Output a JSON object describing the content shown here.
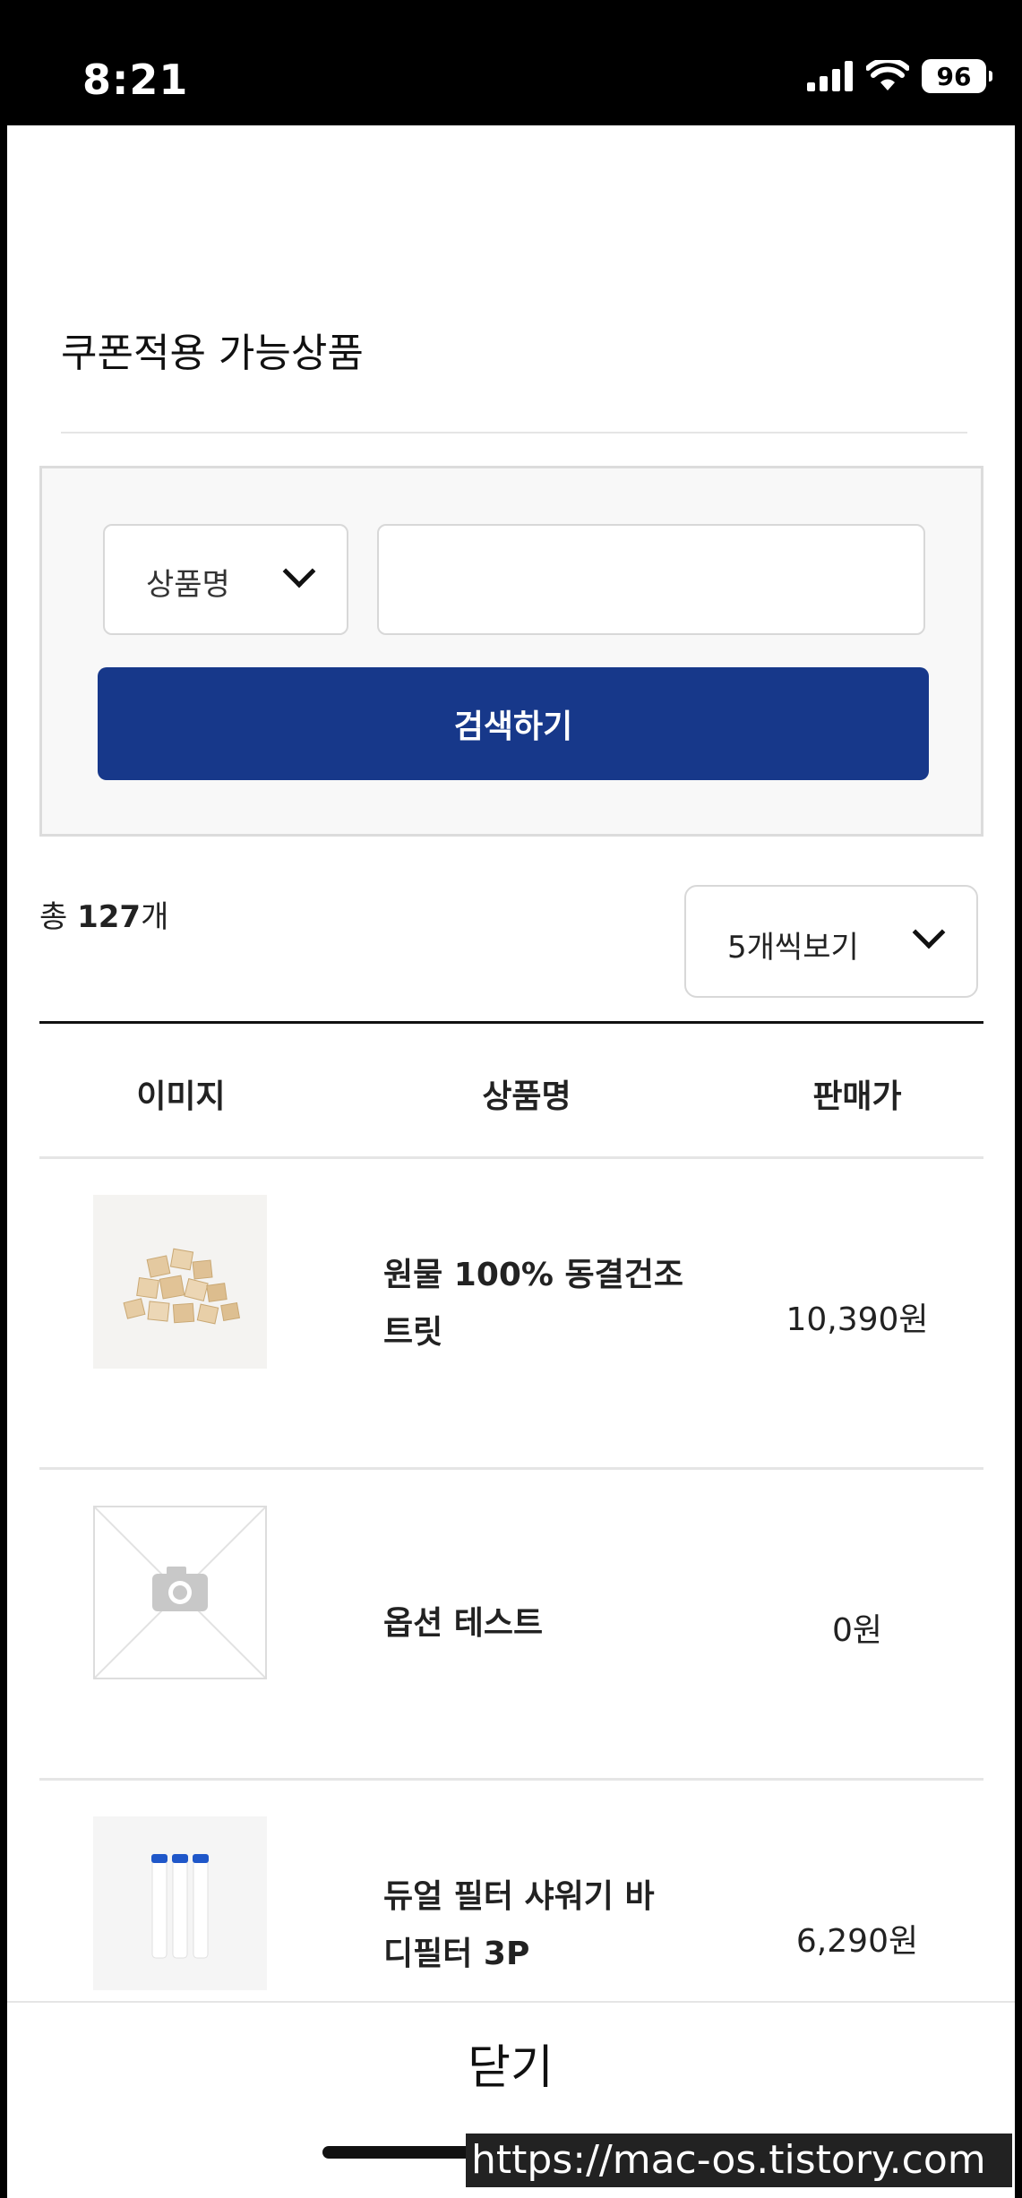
{
  "status_bar": {
    "time": "8:21",
    "battery": "96"
  },
  "title": "쿠폰적용 가능상품",
  "search": {
    "select_label": "상품명",
    "input_value": "",
    "input_placeholder": "",
    "button_label": "검색하기"
  },
  "summary": {
    "prefix": "총 ",
    "count": "127",
    "suffix": "개"
  },
  "per_page": {
    "label": "5개씩보기"
  },
  "table": {
    "headers": {
      "image": "이미지",
      "name": "상품명",
      "price": "판매가"
    },
    "rows": [
      {
        "name_line1": "원물 100% 동결건조",
        "name_line2": "트릿",
        "price": "10,390원"
      },
      {
        "name_line1": "옵션 테스트",
        "name_line2": "",
        "price": "0원"
      },
      {
        "name_line1": "듀얼 필터 샤워기 바",
        "name_line2": "디필터 3P",
        "price": "6,290원"
      }
    ]
  },
  "footer": {
    "close_label": "닫기"
  },
  "watermark": "https://mac-os.tistory.com",
  "colors": {
    "primary": "#17388a",
    "border": "#d8d8d8"
  }
}
